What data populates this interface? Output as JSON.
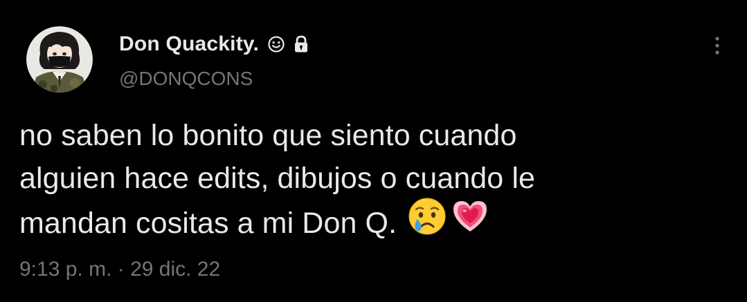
{
  "tweet": {
    "display_name": "Don Quackity.",
    "name_icon": "smiley-face-icon",
    "protected_icon": "lock-icon",
    "handle": "@DONQCONS",
    "text_lines": [
      "no saben lo bonito que siento cuando",
      "alguien hace edits, dibujos o cuando le",
      "mandan cositas a mi Don Q."
    ],
    "emojis": [
      "crying-face-emoji",
      "growing-heart-emoji"
    ],
    "timestamp": "9:13 p. m. · 29 dic. 22",
    "more_icon": "vertical-ellipsis-icon"
  },
  "colors": {
    "background": "#000000",
    "primary_text": "#e7e9ea",
    "secondary_text": "#71767b"
  }
}
